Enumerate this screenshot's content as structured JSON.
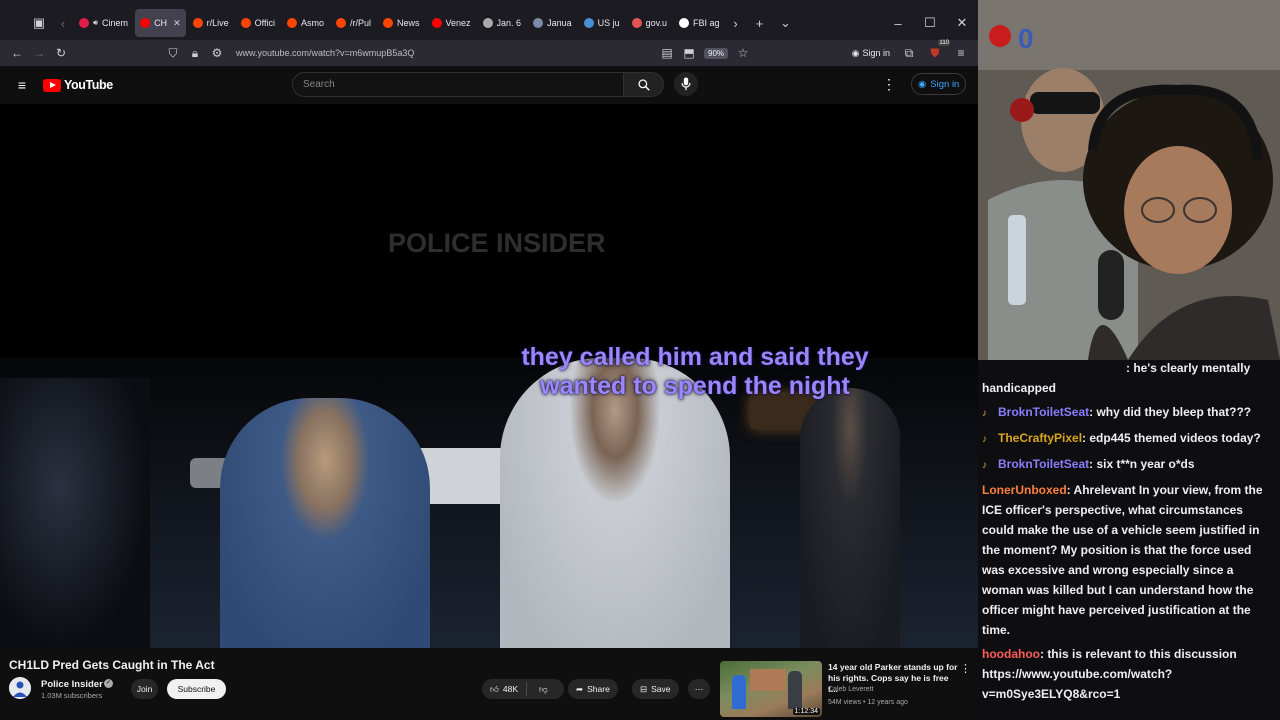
{
  "browser": {
    "tabs": [
      {
        "label": "Cinem",
        "fav": "#e11d48"
      },
      {
        "label": "CH",
        "fav": "#ff0000",
        "active": true
      },
      {
        "label": "r/Live",
        "fav": "#ff4500"
      },
      {
        "label": "Offici",
        "fav": "#ff4500"
      },
      {
        "label": "Asmo",
        "fav": "#ff4500"
      },
      {
        "label": "/r/Pul",
        "fav": "#ff4500"
      },
      {
        "label": "News",
        "fav": "#ff4500"
      },
      {
        "label": "Venez",
        "fav": "#ff0000"
      },
      {
        "label": "Jan. 6",
        "fav": "#aaaaaa"
      },
      {
        "label": "Janua",
        "fav": "#7c8aa5"
      },
      {
        "label": "US ju",
        "fav": "#4a90d9"
      },
      {
        "label": "gov.u",
        "fav": "#e55353"
      },
      {
        "label": "FBI ag",
        "fav": "#ffffff"
      }
    ],
    "url": "www.youtube.com/watch?v=m6wmupB5a3Q",
    "zoom": "90%",
    "sign_in": "Sign in",
    "ext_badge": "110"
  },
  "youtube": {
    "logo": "YouTube",
    "search_placeholder": "Search",
    "sign_in": "Sign in"
  },
  "video": {
    "watermark": "POLICE INSIDER",
    "caption_line1": "they called him and said they",
    "caption_line2": "wanted to spend the night",
    "title": "CH1LD Pred Gets Caught in The Act",
    "channel": "Police Insider",
    "subscribers": "1.03M subscribers",
    "join": "Join",
    "subscribe": "Subscribe",
    "likes": "48K",
    "share": "Share",
    "save": "Save"
  },
  "recommended": {
    "title": "14 year old Parker stands up for his rights. Cops say he is free t...",
    "channel": "Caleb Leverett",
    "meta": "54M views • 12 years ago",
    "duration": "1:12:34"
  },
  "chat": [
    {
      "user": "",
      "text": ": he's clearly mentally handicapped",
      "color": "#efeff1",
      "badge": false,
      "indent": true
    },
    {
      "user": "BroknToiletSeat",
      "text": ": why did they bleep that???",
      "color": "#8a7dff",
      "badge": true
    },
    {
      "user": "TheCraftyPixel",
      "text": ": edp445 themed videos today?",
      "color": "#daa520",
      "badge": true
    },
    {
      "user": "BroknToiletSeat",
      "text": ": six t**n year o*ds",
      "color": "#8a7dff",
      "badge": true
    },
    {
      "user": "LonerUnboxed",
      "text": ": Ahrelevant In your view, from the ICE officer's perspective, what circumstances could make the use of a vehicle seem justified in the moment? My position is that the force used was excessive and wrong especially since a woman was killed but I can understand how the officer might have perceived justification at the time.",
      "color": "#ff7f3f",
      "badge": false
    },
    {
      "user": "hoodahoo",
      "text": ": this is relevant to this discussion https://www.youtube.com/watch?v=m0Sye3ELYQ8&rco=1",
      "color": "#ff5c5c",
      "badge": false
    }
  ],
  "colors": {
    "accent": "#9a86ff",
    "yt_red": "#ff0000"
  }
}
